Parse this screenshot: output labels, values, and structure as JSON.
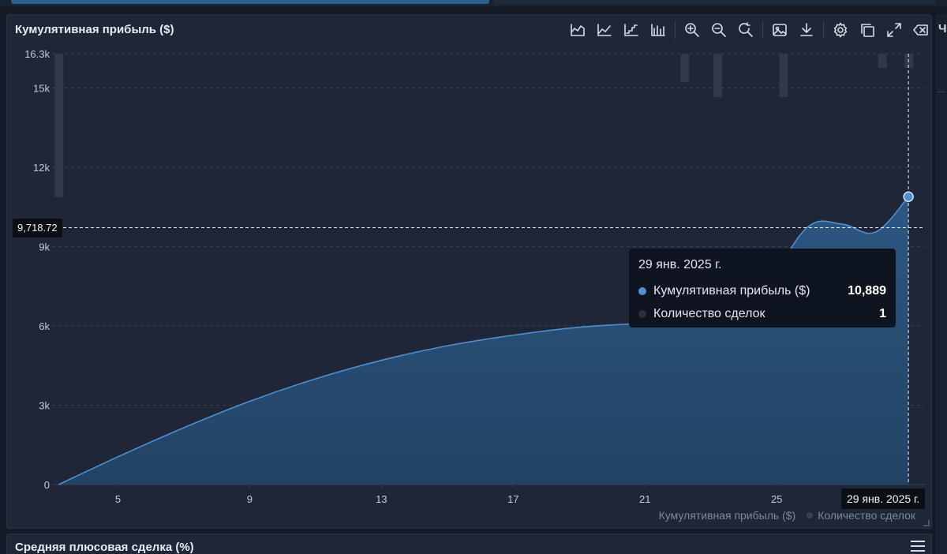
{
  "panel": {
    "title": "Кумулятивная прибыль ($)",
    "toolbar": [
      {
        "name": "area-chart-icon",
        "group": 1
      },
      {
        "name": "line-chart-icon",
        "group": 1
      },
      {
        "name": "step-chart-icon",
        "group": 1
      },
      {
        "name": "bar-chart-icon",
        "group": 1
      },
      {
        "name": "zoom-in-icon",
        "group": 2
      },
      {
        "name": "zoom-out-icon",
        "group": 2
      },
      {
        "name": "reset-zoom-icon",
        "group": 2
      },
      {
        "name": "save-image-icon",
        "group": 3
      },
      {
        "name": "download-icon",
        "group": 3
      },
      {
        "name": "settings-icon",
        "group": 4
      },
      {
        "name": "copy-icon",
        "group": 4
      },
      {
        "name": "fullscreen-icon",
        "group": 4
      },
      {
        "name": "clear-icon",
        "group": 4
      }
    ]
  },
  "chart_data": {
    "type": "area",
    "title": "Кумулятивная прибыль ($)",
    "xlabel": "",
    "ylabel": "",
    "x_ticks": [
      "5",
      "9",
      "13",
      "17",
      "21",
      "25"
    ],
    "x_range": [
      3,
      29.5
    ],
    "y_ticks": [
      "0",
      "3k",
      "6k",
      "9k",
      "12k",
      "15k",
      "16.3k"
    ],
    "y_tick_values": [
      0,
      3000,
      6000,
      9000,
      12000,
      15000,
      16300
    ],
    "ylim": [
      0,
      16300
    ],
    "grid": true,
    "legend_position": "bottom-right",
    "series": [
      {
        "name": "Кумулятивная прибыль ($)",
        "color": "#4f8fd0",
        "points": [
          {
            "x": 3.2,
            "y": 0
          },
          {
            "x": 5,
            "y": 1050
          },
          {
            "x": 7,
            "y": 2150
          },
          {
            "x": 9,
            "y": 3150
          },
          {
            "x": 11,
            "y": 4000
          },
          {
            "x": 13,
            "y": 4700
          },
          {
            "x": 15,
            "y": 5250
          },
          {
            "x": 17,
            "y": 5650
          },
          {
            "x": 19,
            "y": 5950
          },
          {
            "x": 21,
            "y": 6100
          },
          {
            "x": 22,
            "y": 6100
          },
          {
            "x": 23,
            "y": 6080
          },
          {
            "x": 24,
            "y": 6400
          },
          {
            "x": 25,
            "y": 8100
          },
          {
            "x": 26,
            "y": 9800
          },
          {
            "x": 27,
            "y": 9850
          },
          {
            "x": 28,
            "y": 9550
          },
          {
            "x": 29,
            "y": 10889
          }
        ]
      },
      {
        "name": "Количество сделок",
        "color": "#2f3949",
        "bars": [
          {
            "x": 3.2,
            "count": 1
          },
          {
            "x": 22.2,
            "count": 1
          },
          {
            "x": 23.2,
            "count": 1
          },
          {
            "x": 25.2,
            "count": 1
          },
          {
            "x": 28.2,
            "count": 1
          },
          {
            "x": 29,
            "count": 1
          }
        ]
      }
    ],
    "crosshair": {
      "x": 29,
      "y_label": "9,718.72",
      "x_label": "29 янв. 2025 г."
    },
    "tooltip": {
      "date": "29 янв. 2025 г.",
      "rows": [
        {
          "name": "Кумулятивная прибыль ($)",
          "value": "10,889",
          "dot": "#4f8fd0"
        },
        {
          "name": "Количество сделок",
          "value": "1",
          "dot": "#2a2f38"
        }
      ]
    },
    "legend": [
      {
        "name": "Кумулятивная прибыль ($)",
        "dot": "#4f8fd0"
      },
      {
        "name": "Количество сделок",
        "dot": "#3a4250"
      }
    ]
  },
  "right_edge": {
    "label": "Ч"
  },
  "panel2": {
    "title": "Средняя плюсовая сделка (%)"
  }
}
